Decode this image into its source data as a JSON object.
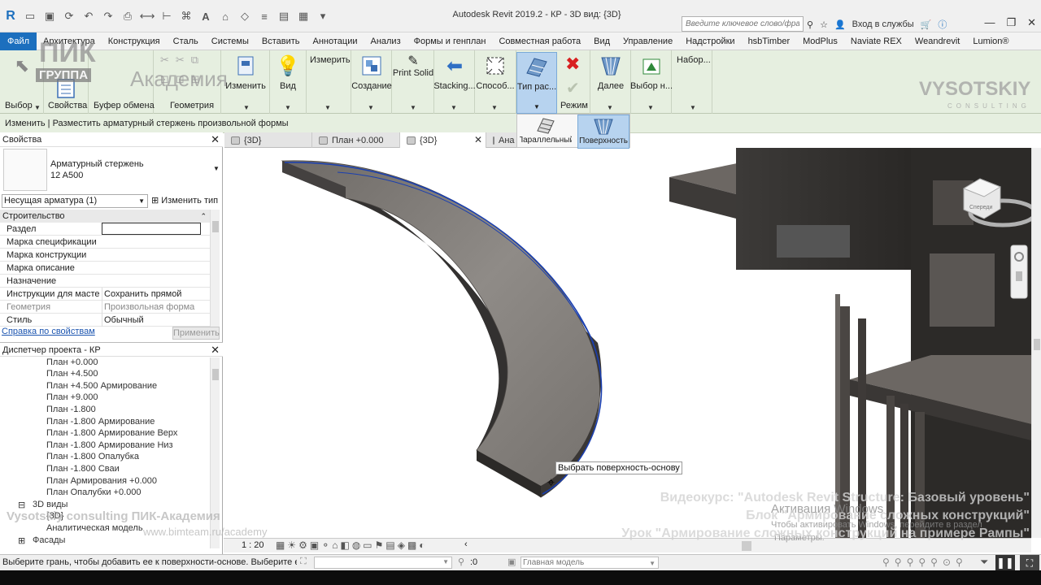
{
  "titlebar": {
    "title": "Autodesk Revit 2019.2 - КР - 3D вид: {3D}",
    "search_placeholder": "Введите ключевое слово/фразу",
    "signin": "Вход в службы"
  },
  "menu": [
    "Файл",
    "Архитектура",
    "Конструкция",
    "Сталь",
    "Системы",
    "Вставить",
    "Аннотации",
    "Анализ",
    "Формы и генплан",
    "Совместная работа",
    "Вид",
    "Управление",
    "Надстройки",
    "hsbTimber",
    "ModPlus",
    "Naviate REX",
    "Weandrevit",
    "Lumion®"
  ],
  "ribbon": {
    "select_label": "Выбор",
    "properties_label": "Свойства",
    "clipboard_label": "Буфер обмена",
    "geometry_label": "Геометрия",
    "modify_label": "Изменить",
    "view_label": "Вид",
    "measure_label": "Измерить",
    "create_label": "Создание",
    "print_solid": "Print Solid",
    "stacking": "Stacking...",
    "method": "Способ...",
    "layout_type": "Тип рас...",
    "mode_label": "Режим",
    "next": "Далее",
    "select_n": "Выбор н...",
    "set": "Набор..."
  },
  "dropdown": {
    "parallel": "Параллельный",
    "surface": "Поверхность"
  },
  "optionsbar": "Изменить | Разместить арматурный стержень произвольной формы",
  "tabs": [
    {
      "label": "{3D}"
    },
    {
      "label": "План +0.000"
    },
    {
      "label": "{3D}"
    },
    {
      "label": "Ана"
    }
  ],
  "properties": {
    "header": "Свойства",
    "type_name": "Арматурный стержень",
    "type_sub": "12 A500",
    "filter": "Несущая арматура (1)",
    "edit_type": "Изменить тип",
    "section": "Строительство",
    "rows": [
      {
        "k": "Раздел",
        "v": ""
      },
      {
        "k": "Марка спецификации",
        "v": ""
      },
      {
        "k": "Марка конструкции",
        "v": ""
      },
      {
        "k": "Марка описание",
        "v": ""
      },
      {
        "k": "Назначение",
        "v": ""
      },
      {
        "k": "Инструкции для мастер...",
        "v": "Сохранить прямой"
      },
      {
        "k": "Геометрия",
        "v": "Произвольная форма"
      },
      {
        "k": "Стиль",
        "v": "Обычный"
      }
    ],
    "help_link": "Справка по свойствам",
    "apply": "Применить"
  },
  "browser": {
    "header": "Диспетчер проекта - КР",
    "items": [
      "План +0.000",
      "План +4.500",
      "План +4.500 Армирование",
      "План +9.000",
      "План -1.800",
      "План -1.800 Армирование",
      "План -1.800 Армирование Верх",
      "План -1.800 Армирование Низ",
      "План -1.800 Опалубка",
      "План -1.800 Сваи",
      "План Армирования +0.000",
      "План Опалубки +0.000"
    ],
    "group_3d": "3D виды",
    "sub_3d": "{3D}",
    "sub_analytical": "Аналитическая модель",
    "group_facades": "Фасады"
  },
  "viewport": {
    "tooltip": "Выбрать поверхность-основу",
    "scale": "1 : 20",
    "viewcube_front": "Спереди"
  },
  "status": {
    "hint": "Выберите грань, чтобы добавить ее к поверхности-основе. Выберите еще ра:",
    "zero": ":0",
    "model": "Главная модель"
  },
  "watermarks": {
    "pik": "ПИК",
    "group": "ГРУППА",
    "academy": "Академия",
    "vysotskiy": "VYSOTSKIY",
    "consulting": "CONSULTING",
    "left_line": "Vysotskiy consulting  ПИК-Академия",
    "url": "www.bimteam.ru/academy",
    "course1": "Видеокурс: \"Autodesk Revit Structure: Базовый уровень\"",
    "course2": "Блок \"Армирование сложных конструкций\"",
    "course3": "Урок \"Армирование сложных конструкций на примере Рампы\"",
    "activation1": "Активация Windows",
    "activation2": "Чтобы активировать Windows, перейдите в раздел",
    "activation3": "Параметры."
  },
  "colors": {
    "file_tab": "#1c6fbe",
    "ribbon_bg": "#e6efe0",
    "selection": "#b7d3ef",
    "rebar_line": "#1a3fb0"
  }
}
